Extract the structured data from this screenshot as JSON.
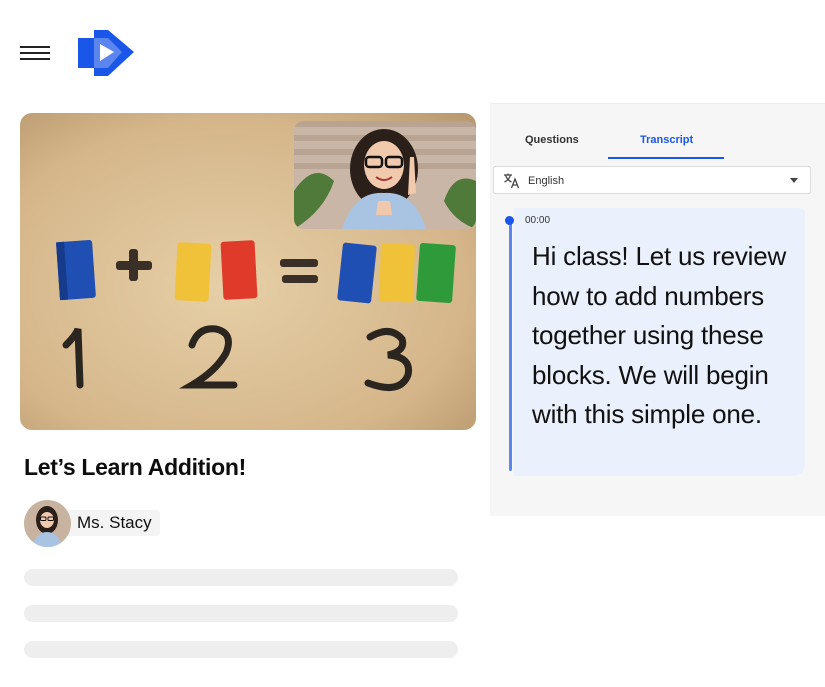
{
  "header": {
    "menu_icon": "hamburger-menu-icon",
    "logo_icon": "play-logo-icon",
    "brand_color": "#1a56e8"
  },
  "video": {
    "equation": [
      "1",
      "+",
      "2",
      "=",
      "3"
    ],
    "block_colors": [
      "#1f4fb3",
      "#f0c23a",
      "#e03a2a",
      "#2f9a3a"
    ]
  },
  "lesson": {
    "title": "Let’s Learn Addition!",
    "author": "Ms. Stacy"
  },
  "panel": {
    "tabs": [
      {
        "label": "Questions",
        "active": false
      },
      {
        "label": "Transcript",
        "active": true
      }
    ],
    "language": {
      "value": "English",
      "icon": "translate-icon"
    },
    "transcript": [
      {
        "time": "00:00",
        "text": "Hi class! Let us review how to add numbers together using these blocks. We will begin with this simple one."
      }
    ]
  }
}
